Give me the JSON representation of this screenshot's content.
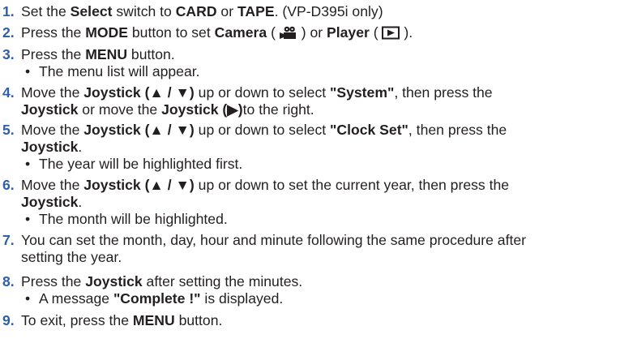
{
  "steps": [
    {
      "num": "1.",
      "parts": [
        "Set the ",
        "Select",
        " switch to ",
        "CARD",
        " or ",
        "TAPE",
        ". (VP-D395i only)"
      ]
    },
    {
      "num": "2.",
      "parts": [
        "Press the ",
        "MODE",
        " button to set ",
        "Camera",
        " ( ",
        " ) or ",
        "Player",
        " ( ",
        " )."
      ],
      "icons": [
        "camera-mode-icon",
        "player-mode-icon"
      ]
    },
    {
      "num": "3.",
      "parts": [
        "Press the ",
        "MENU",
        " button."
      ],
      "bullet": "The menu list will appear."
    },
    {
      "num": "4.",
      "line1": [
        "Move the ",
        "Joystick (▲ / ▼)",
        " up or down to select ",
        "\"System\"",
        ", then press the"
      ],
      "line2": [
        "Joystick",
        " or move the ",
        "Joystick (▶)",
        "to the right."
      ]
    },
    {
      "num": "5.",
      "line1": [
        "Move the ",
        "Joystick (▲ / ▼)",
        " up or down to select ",
        "\"Clock Set\"",
        ", then press the"
      ],
      "line2": [
        "Joystick",
        "."
      ],
      "bullet": "The year will be highlighted first."
    },
    {
      "num": "6.",
      "line1": [
        "Move the ",
        "Joystick (▲ / ▼)",
        " up or down to set the current year, then press the"
      ],
      "line2": [
        "Joystick",
        "."
      ],
      "bullet": "The month will be highlighted."
    },
    {
      "num": "7.",
      "line1": [
        "You can set the month, day, hour and minute following the same procedure after"
      ],
      "line2": [
        "setting the year."
      ]
    },
    {
      "num": "8.",
      "parts": [
        "Press the ",
        "Joystick",
        " after setting the minutes."
      ],
      "bullet_parts": [
        "A message ",
        "\"Complete !\"",
        " is displayed."
      ]
    },
    {
      "num": "9.",
      "parts": [
        "To exit, press the ",
        "MENU",
        " button."
      ]
    }
  ],
  "bullet_symbol": "•",
  "colors": {
    "step_number": "#2f5fa8",
    "text": "#231f20"
  }
}
